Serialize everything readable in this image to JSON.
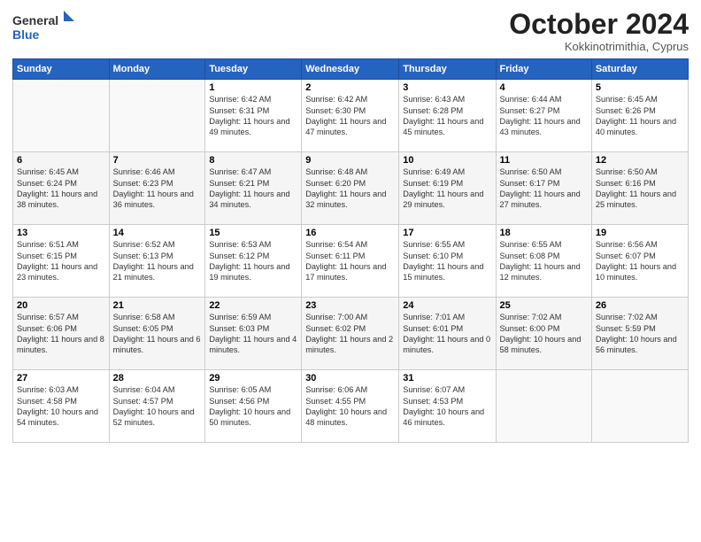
{
  "header": {
    "logo_general": "General",
    "logo_blue": "Blue",
    "month_title": "October 2024",
    "location": "Kokkinotrimithia, Cyprus"
  },
  "weekdays": [
    "Sunday",
    "Monday",
    "Tuesday",
    "Wednesday",
    "Thursday",
    "Friday",
    "Saturday"
  ],
  "weeks": [
    [
      {
        "day": "",
        "info": ""
      },
      {
        "day": "",
        "info": ""
      },
      {
        "day": "1",
        "info": "Sunrise: 6:42 AM\nSunset: 6:31 PM\nDaylight: 11 hours and 49 minutes."
      },
      {
        "day": "2",
        "info": "Sunrise: 6:42 AM\nSunset: 6:30 PM\nDaylight: 11 hours and 47 minutes."
      },
      {
        "day": "3",
        "info": "Sunrise: 6:43 AM\nSunset: 6:28 PM\nDaylight: 11 hours and 45 minutes."
      },
      {
        "day": "4",
        "info": "Sunrise: 6:44 AM\nSunset: 6:27 PM\nDaylight: 11 hours and 43 minutes."
      },
      {
        "day": "5",
        "info": "Sunrise: 6:45 AM\nSunset: 6:26 PM\nDaylight: 11 hours and 40 minutes."
      }
    ],
    [
      {
        "day": "6",
        "info": "Sunrise: 6:45 AM\nSunset: 6:24 PM\nDaylight: 11 hours and 38 minutes."
      },
      {
        "day": "7",
        "info": "Sunrise: 6:46 AM\nSunset: 6:23 PM\nDaylight: 11 hours and 36 minutes."
      },
      {
        "day": "8",
        "info": "Sunrise: 6:47 AM\nSunset: 6:21 PM\nDaylight: 11 hours and 34 minutes."
      },
      {
        "day": "9",
        "info": "Sunrise: 6:48 AM\nSunset: 6:20 PM\nDaylight: 11 hours and 32 minutes."
      },
      {
        "day": "10",
        "info": "Sunrise: 6:49 AM\nSunset: 6:19 PM\nDaylight: 11 hours and 29 minutes."
      },
      {
        "day": "11",
        "info": "Sunrise: 6:50 AM\nSunset: 6:17 PM\nDaylight: 11 hours and 27 minutes."
      },
      {
        "day": "12",
        "info": "Sunrise: 6:50 AM\nSunset: 6:16 PM\nDaylight: 11 hours and 25 minutes."
      }
    ],
    [
      {
        "day": "13",
        "info": "Sunrise: 6:51 AM\nSunset: 6:15 PM\nDaylight: 11 hours and 23 minutes."
      },
      {
        "day": "14",
        "info": "Sunrise: 6:52 AM\nSunset: 6:13 PM\nDaylight: 11 hours and 21 minutes."
      },
      {
        "day": "15",
        "info": "Sunrise: 6:53 AM\nSunset: 6:12 PM\nDaylight: 11 hours and 19 minutes."
      },
      {
        "day": "16",
        "info": "Sunrise: 6:54 AM\nSunset: 6:11 PM\nDaylight: 11 hours and 17 minutes."
      },
      {
        "day": "17",
        "info": "Sunrise: 6:55 AM\nSunset: 6:10 PM\nDaylight: 11 hours and 15 minutes."
      },
      {
        "day": "18",
        "info": "Sunrise: 6:55 AM\nSunset: 6:08 PM\nDaylight: 11 hours and 12 minutes."
      },
      {
        "day": "19",
        "info": "Sunrise: 6:56 AM\nSunset: 6:07 PM\nDaylight: 11 hours and 10 minutes."
      }
    ],
    [
      {
        "day": "20",
        "info": "Sunrise: 6:57 AM\nSunset: 6:06 PM\nDaylight: 11 hours and 8 minutes."
      },
      {
        "day": "21",
        "info": "Sunrise: 6:58 AM\nSunset: 6:05 PM\nDaylight: 11 hours and 6 minutes."
      },
      {
        "day": "22",
        "info": "Sunrise: 6:59 AM\nSunset: 6:03 PM\nDaylight: 11 hours and 4 minutes."
      },
      {
        "day": "23",
        "info": "Sunrise: 7:00 AM\nSunset: 6:02 PM\nDaylight: 11 hours and 2 minutes."
      },
      {
        "day": "24",
        "info": "Sunrise: 7:01 AM\nSunset: 6:01 PM\nDaylight: 11 hours and 0 minutes."
      },
      {
        "day": "25",
        "info": "Sunrise: 7:02 AM\nSunset: 6:00 PM\nDaylight: 10 hours and 58 minutes."
      },
      {
        "day": "26",
        "info": "Sunrise: 7:02 AM\nSunset: 5:59 PM\nDaylight: 10 hours and 56 minutes."
      }
    ],
    [
      {
        "day": "27",
        "info": "Sunrise: 6:03 AM\nSunset: 4:58 PM\nDaylight: 10 hours and 54 minutes."
      },
      {
        "day": "28",
        "info": "Sunrise: 6:04 AM\nSunset: 4:57 PM\nDaylight: 10 hours and 52 minutes."
      },
      {
        "day": "29",
        "info": "Sunrise: 6:05 AM\nSunset: 4:56 PM\nDaylight: 10 hours and 50 minutes."
      },
      {
        "day": "30",
        "info": "Sunrise: 6:06 AM\nSunset: 4:55 PM\nDaylight: 10 hours and 48 minutes."
      },
      {
        "day": "31",
        "info": "Sunrise: 6:07 AM\nSunset: 4:53 PM\nDaylight: 10 hours and 46 minutes."
      },
      {
        "day": "",
        "info": ""
      },
      {
        "day": "",
        "info": ""
      }
    ]
  ]
}
